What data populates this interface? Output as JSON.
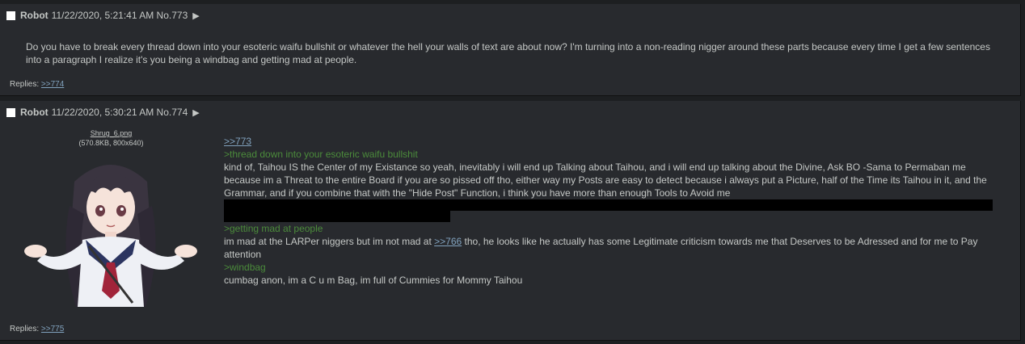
{
  "posts": [
    {
      "name": "Robot",
      "date": "11/22/2020, 5:21:41 AM",
      "number": "No.773",
      "body": "Do you have to break every thread down into your esoteric waifu bullshit or whatever the hell your walls of text are about now? I'm turning into a non-reading nigger around these parts because every time I get a few sentences into a paragraph I realize it's you being a windbag and getting mad at people.",
      "replies_label": "Replies:",
      "reply_link": ">>774"
    },
    {
      "name": "Robot",
      "date": "11/22/2020, 5:30:21 AM",
      "number": "No.774",
      "file_name": "Shrug_6.png",
      "file_meta": "(570.8KB, 800x640)",
      "quote_link": ">>773",
      "green1": ">thread down into your esoteric waifu bullshit",
      "text1": "kind of, Taihou IS the Center of my Existance so yeah, inevitably i will end up Talking about Taihou, and i will end up talking about the Divine, Ask BO -Sama to Permaban me because im a Threat to the entire Board if you are so pissed off tho, either way my Posts are easy to detect because i always put a Picture, half of the Time its Taihou in it, and the Grammar, and if you combine that with the \"Hide Post\" Function, i think you have more than enough Tools to Avoid me",
      "green2": ">getting mad at people",
      "text2_before": "im mad at the LARPer niggers but im not mad at ",
      "text2_link": ">>766",
      "text2_after": " tho, he looks like he actually has some Legitimate criticism towards me that Deserves to be Adressed and for me to Pay attention",
      "green3": ">windbag",
      "text3": "cumbag anon, im a C u m Bag, im full of Cummies for Mommy Taihou",
      "replies_label": "Replies:",
      "reply_link": ">>775"
    }
  ],
  "colors": {
    "background": "#1d1f21",
    "post_bg": "#282a2e",
    "text": "#c5c8c6",
    "link": "#81a2be",
    "greentext": "#4b8b3b"
  }
}
